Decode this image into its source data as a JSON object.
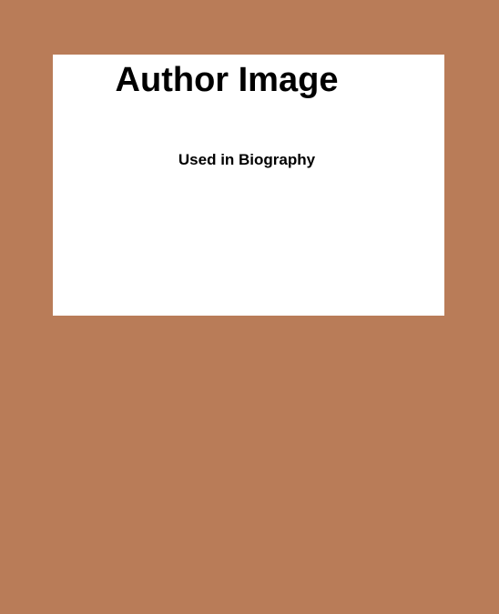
{
  "placeholder": {
    "title": "Author Image",
    "subtitle": "Used in Biography"
  },
  "colors": {
    "background": "#b97c58",
    "card": "#ffffff",
    "text": "#000000"
  }
}
